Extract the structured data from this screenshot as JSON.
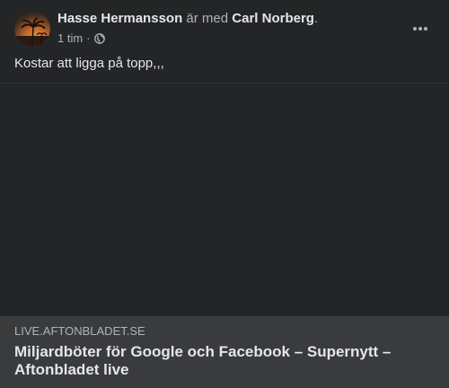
{
  "post": {
    "author": "Hasse Hermansson",
    "connector": " är med ",
    "tagged": "Carl Norberg",
    "period": ".",
    "time": "1 tim",
    "separator": "·",
    "privacy_icon": "globe-icon",
    "more_icon": "more-horizontal-icon",
    "text": "Kostar att ligga på topp,,,"
  },
  "link": {
    "domain": "LIVE.AFTONBLADET.SE",
    "title": "Miljardböter för Google och Facebook – Supernytt – Aftonbladet live"
  },
  "colors": {
    "card_bg": "#242526",
    "link_footer_bg": "#3a3b3c",
    "primary_text": "#e4e6eb",
    "secondary_text": "#b0b3b8"
  }
}
